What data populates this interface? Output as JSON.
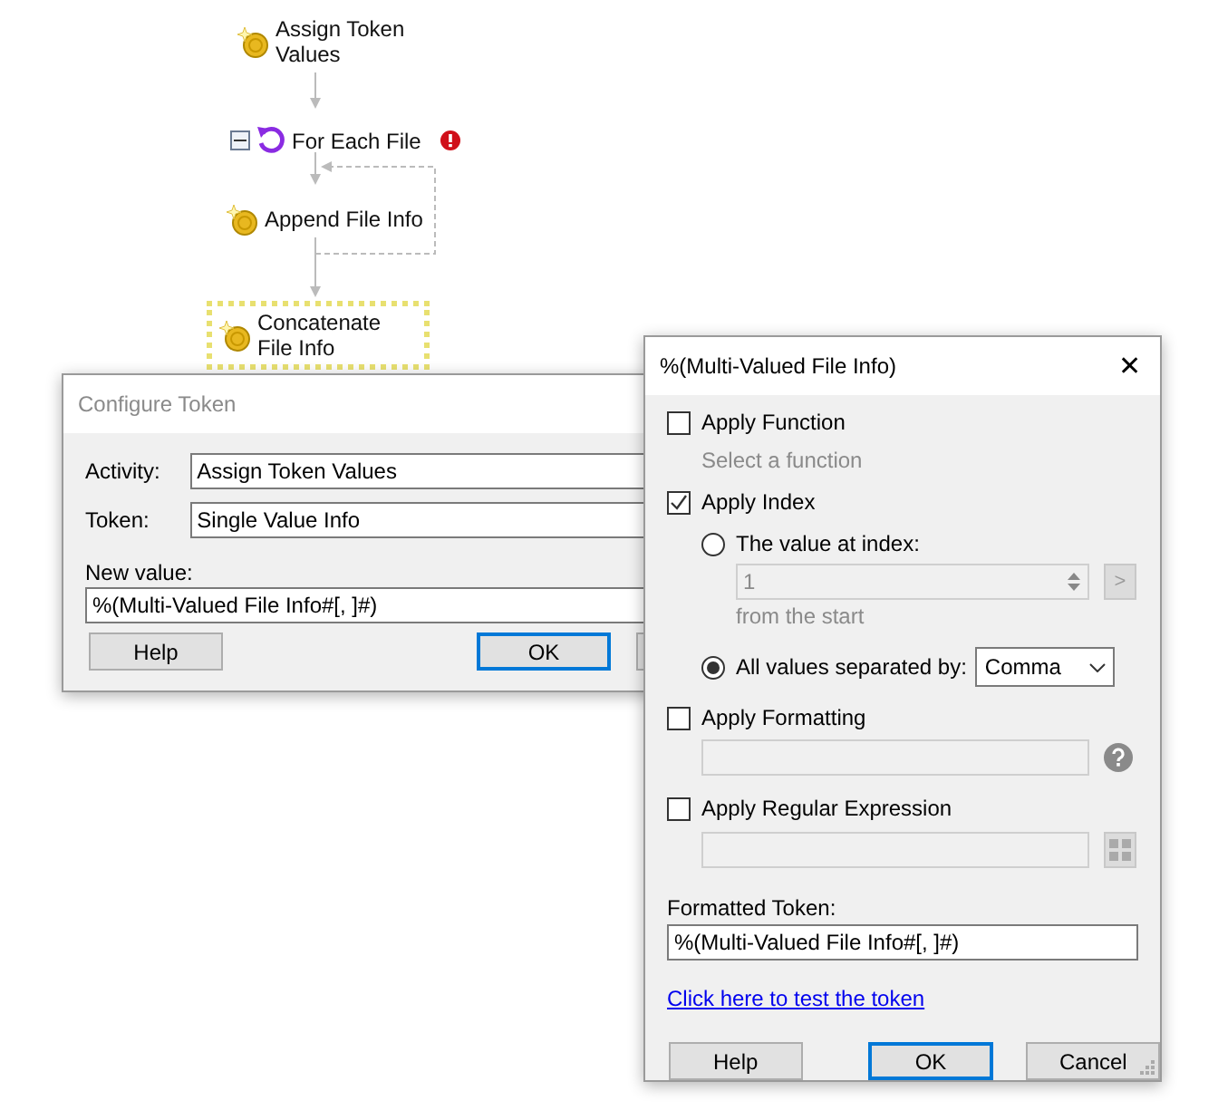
{
  "flow": {
    "nodes": [
      {
        "kind": "activity",
        "label": "Assign Token Values",
        "selected": false
      },
      {
        "kind": "loop",
        "label": "For Each File",
        "selected": false,
        "expanded": true,
        "error": true
      },
      {
        "kind": "activity",
        "label": "Append File Info",
        "selected": false
      },
      {
        "kind": "activity",
        "label": "Concatenate File Info",
        "selected": true
      }
    ]
  },
  "configure_token": {
    "title": "Configure Token",
    "active": false,
    "activity": {
      "label": "Activity:",
      "value": "Assign Token Values"
    },
    "token": {
      "label": "Token:",
      "value": "Single Value Info"
    },
    "new_value": {
      "label": "New value:",
      "value": "%(Multi-Valued File Info#[, ]#)"
    },
    "buttons": [
      {
        "label": "Help",
        "default": false
      },
      {
        "label": "OK",
        "default": true
      }
    ]
  },
  "token_dialog": {
    "title": "%(Multi-Valued File Info)",
    "close": "✕",
    "apply_function": {
      "label": "Apply Function",
      "checked": false,
      "hint": "Select a function"
    },
    "apply_index": {
      "label": "Apply Index",
      "checked": true,
      "options": [
        {
          "kind": "index",
          "label": "The value at index:",
          "selected": false,
          "value": "1",
          "button": ">",
          "hint": "from the  start"
        },
        {
          "kind": "separator",
          "label": "All values separated by:",
          "selected": true,
          "value": "Comma"
        }
      ]
    },
    "apply_formatting": {
      "label": "Apply Formatting",
      "checked": false
    },
    "apply_regex": {
      "label": "Apply Regular Expression",
      "checked": false
    },
    "formatted_token": {
      "label": "Formatted Token:",
      "value": "%(Multi-Valued File Info#[, ]#)"
    },
    "link": "Click here to test the token",
    "buttons": [
      {
        "label": "Help",
        "default": false
      },
      {
        "label": "OK",
        "default": true
      },
      {
        "label": "Cancel",
        "default": false
      }
    ]
  }
}
